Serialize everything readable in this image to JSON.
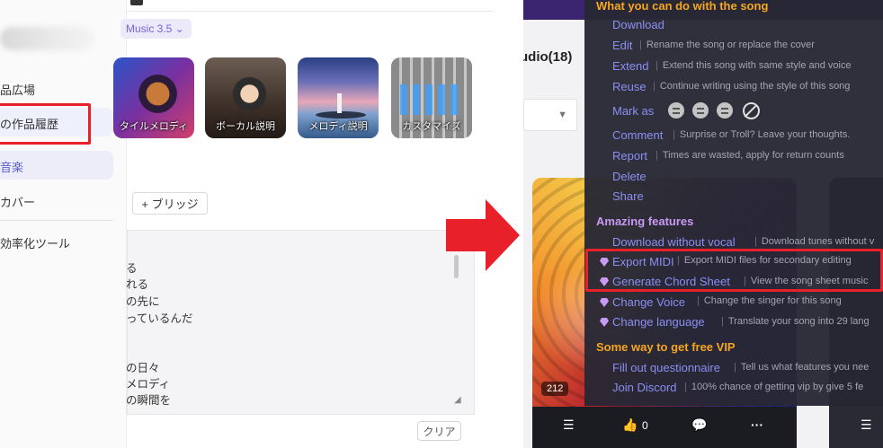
{
  "left": {
    "sidebar": {
      "items": [
        {
          "label": "品広場"
        },
        {
          "label": "の作品履歴"
        },
        {
          "label": "音楽"
        },
        {
          "label": "カバー"
        },
        {
          "label": "効率化ツール"
        }
      ]
    },
    "model_chip": "Music 3.5 ⌄",
    "tiles": [
      {
        "label": "タイルメロディ"
      },
      {
        "label": "ボーカル説明"
      },
      {
        "label": "メロディ説明"
      },
      {
        "label": "カスタマイズ"
      }
    ],
    "bridge_button": "+ ブリッジ",
    "lyrics": [
      "る",
      "れる",
      "の先に",
      "っているんだ",
      "の日々",
      "メロディ",
      "の瞬間を"
    ],
    "clear_button": "クリア"
  },
  "right": {
    "studio_tab": "udio(18)",
    "menu": {
      "section1": {
        "title": "What you can do with the song",
        "color": "#f5a623",
        "items": [
          {
            "label": "Download",
            "desc": ""
          },
          {
            "label": "Edit",
            "desc": "Rename the song or replace the cover"
          },
          {
            "label": "Extend",
            "desc": "Extend this song with same style and voice"
          },
          {
            "label": "Reuse",
            "desc": "Continue writing using the style of this song"
          },
          {
            "label": "Mark as",
            "desc": ""
          },
          {
            "label": "Comment",
            "desc": "Surprise or Troll? Leave your thoughts."
          },
          {
            "label": "Report",
            "desc": "Times are wasted, apply for return counts"
          },
          {
            "label": "Delete",
            "desc": ""
          },
          {
            "label": "Share",
            "desc": ""
          }
        ]
      },
      "section2": {
        "title": "Amazing features",
        "color": "#c89af5",
        "items": [
          {
            "label": "Download without vocal",
            "desc": "Download tunes without v"
          },
          {
            "label": "Export MIDI",
            "desc": "Export MIDI files for secondary editing"
          },
          {
            "label": "Generate Chord Sheet",
            "desc": "View the song sheet music"
          },
          {
            "label": "Change Voice",
            "desc": "Change the singer for this song"
          },
          {
            "label": "Change language",
            "desc": "Translate your song into 29 lang"
          }
        ]
      },
      "section3": {
        "title": "Some way to get free VIP",
        "color": "#f5a623",
        "items": [
          {
            "label": "Fill out questionnaire",
            "desc": "Tell us what features you nee"
          },
          {
            "label": "Join Discord",
            "desc": "100% chance of getting vip by give 5 fe"
          }
        ]
      }
    },
    "card": {
      "count": "212",
      "likes": "0"
    }
  },
  "colors": {
    "accent_red": "#e8202a",
    "link_purple": "#8b8ff2",
    "menu_bg": "#282834"
  }
}
